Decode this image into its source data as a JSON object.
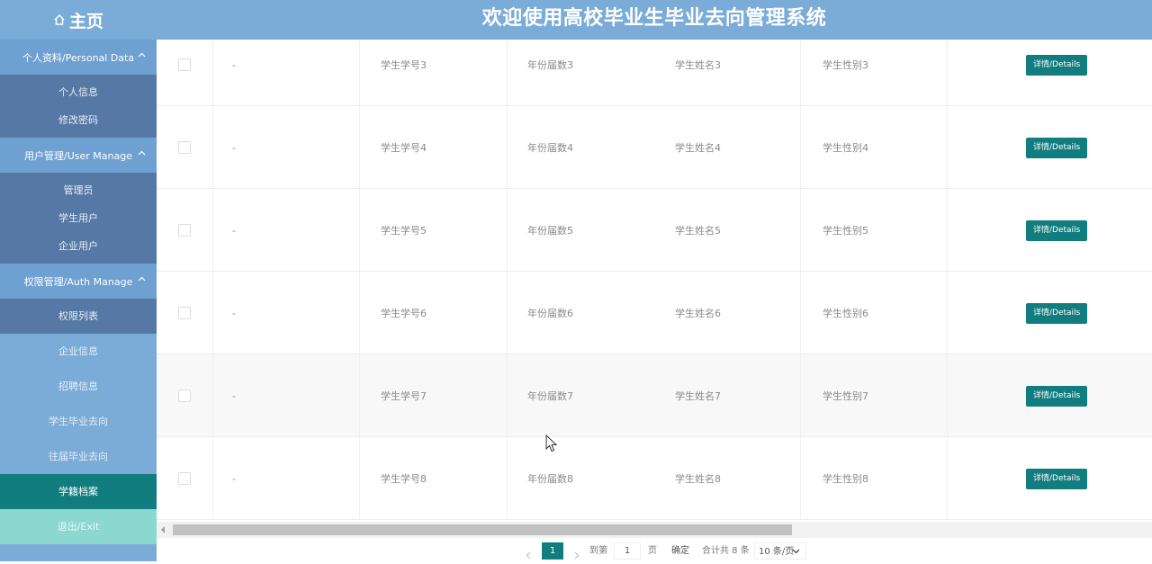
{
  "header": {
    "home_label": "主页",
    "title": "欢迎使用高校毕业生毕业去向管理系统"
  },
  "sidebar": {
    "group_personal": "个人资料/Personal Data",
    "personal_items": [
      "个人信息",
      "修改密码"
    ],
    "group_user": "用户管理/User Manage",
    "user_items": [
      "管理员",
      "学生用户",
      "企业用户"
    ],
    "group_auth": "权限管理/Auth Manage",
    "auth_items": [
      "权限列表"
    ],
    "menu": [
      "企业信息",
      "招聘信息",
      "学生毕业去向",
      "往届毕业去向",
      "学籍档案"
    ],
    "exit": "退出/Exit"
  },
  "table": {
    "rows": [
      {
        "dash": "-",
        "student_no": "学生学号3",
        "year": "年份届数3",
        "name": "学生姓名3",
        "gender": "学生性别3",
        "action": "详情/Details"
      },
      {
        "dash": "-",
        "student_no": "学生学号4",
        "year": "年份届数4",
        "name": "学生姓名4",
        "gender": "学生性别4",
        "action": "详情/Details"
      },
      {
        "dash": "-",
        "student_no": "学生学号5",
        "year": "年份届数5",
        "name": "学生姓名5",
        "gender": "学生性别5",
        "action": "详情/Details"
      },
      {
        "dash": "-",
        "student_no": "学生学号6",
        "year": "年份届数6",
        "name": "学生姓名6",
        "gender": "学生性别6",
        "action": "详情/Details"
      },
      {
        "dash": "-",
        "student_no": "学生学号7",
        "year": "年份届数7",
        "name": "学生姓名7",
        "gender": "学生性别7",
        "action": "详情/Details"
      },
      {
        "dash": "-",
        "student_no": "学生学号8",
        "year": "年份届数8",
        "name": "学生姓名8",
        "gender": "学生性别8",
        "action": "详情/Details"
      }
    ]
  },
  "pagination": {
    "current_page": "1",
    "goto_label": "到第",
    "goto_value": "1",
    "page_unit": "页",
    "confirm": "确定",
    "total": "合计共 8 条",
    "page_size": "10 条/页"
  },
  "colors": {
    "header": "#7bacd7",
    "sidebar_dark": "#5678a4",
    "accent": "#127d7e",
    "exit": "#8cd8d0"
  }
}
